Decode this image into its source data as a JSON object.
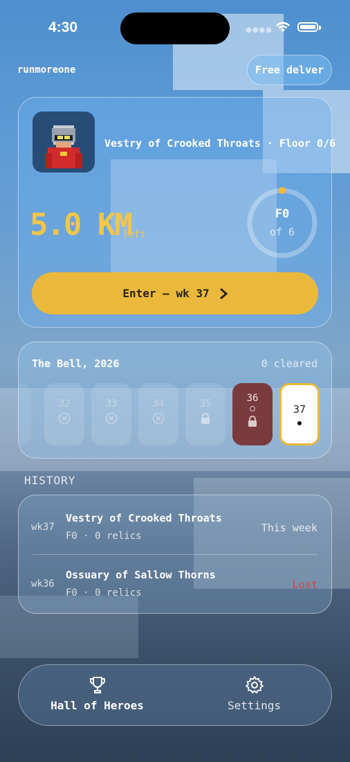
{
  "status_bar": {
    "time": "4:30"
  },
  "header": {
    "username": "runmoreone",
    "free_button": "Free delver"
  },
  "run_card": {
    "dungeon_line": "Vestry of Crooked Throats · Floor 0/6",
    "distance_value": "5.0 KM",
    "distance_unit": "left",
    "ring_floor": "F0",
    "ring_of": "of 6",
    "ring_progress": 0,
    "enter_label": "Enter — wk 37"
  },
  "bell": {
    "title": "The Bell, 2026",
    "cleared": "0 cleared",
    "weeks": [
      {
        "num": "32",
        "state": "missed"
      },
      {
        "num": "33",
        "state": "missed"
      },
      {
        "num": "34",
        "state": "missed"
      },
      {
        "num": "35",
        "state": "locked"
      },
      {
        "num": "36",
        "state": "locked-red"
      },
      {
        "num": "37",
        "state": "current"
      }
    ]
  },
  "history": {
    "label": "HISTORY",
    "rows": [
      {
        "week": "wk37",
        "name": "Vestry of Crooked Throats",
        "meta": "F0 · 0 relics",
        "status": "This week"
      },
      {
        "week": "wk36",
        "name": "Ossuary of Sallow Thorns",
        "meta": "F0 · 0 relics",
        "status": "Lost"
      }
    ]
  },
  "tabbar": {
    "tabs": [
      {
        "label": "Hall of Heroes",
        "icon": "trophy-icon",
        "active": true
      },
      {
        "label": "Settings",
        "icon": "gear-icon",
        "active": false
      }
    ]
  },
  "colors": {
    "accent": "#eab93c",
    "distance": "#f2c64a",
    "lost": "#d8433e",
    "locked_week": "#7a3b3e"
  }
}
